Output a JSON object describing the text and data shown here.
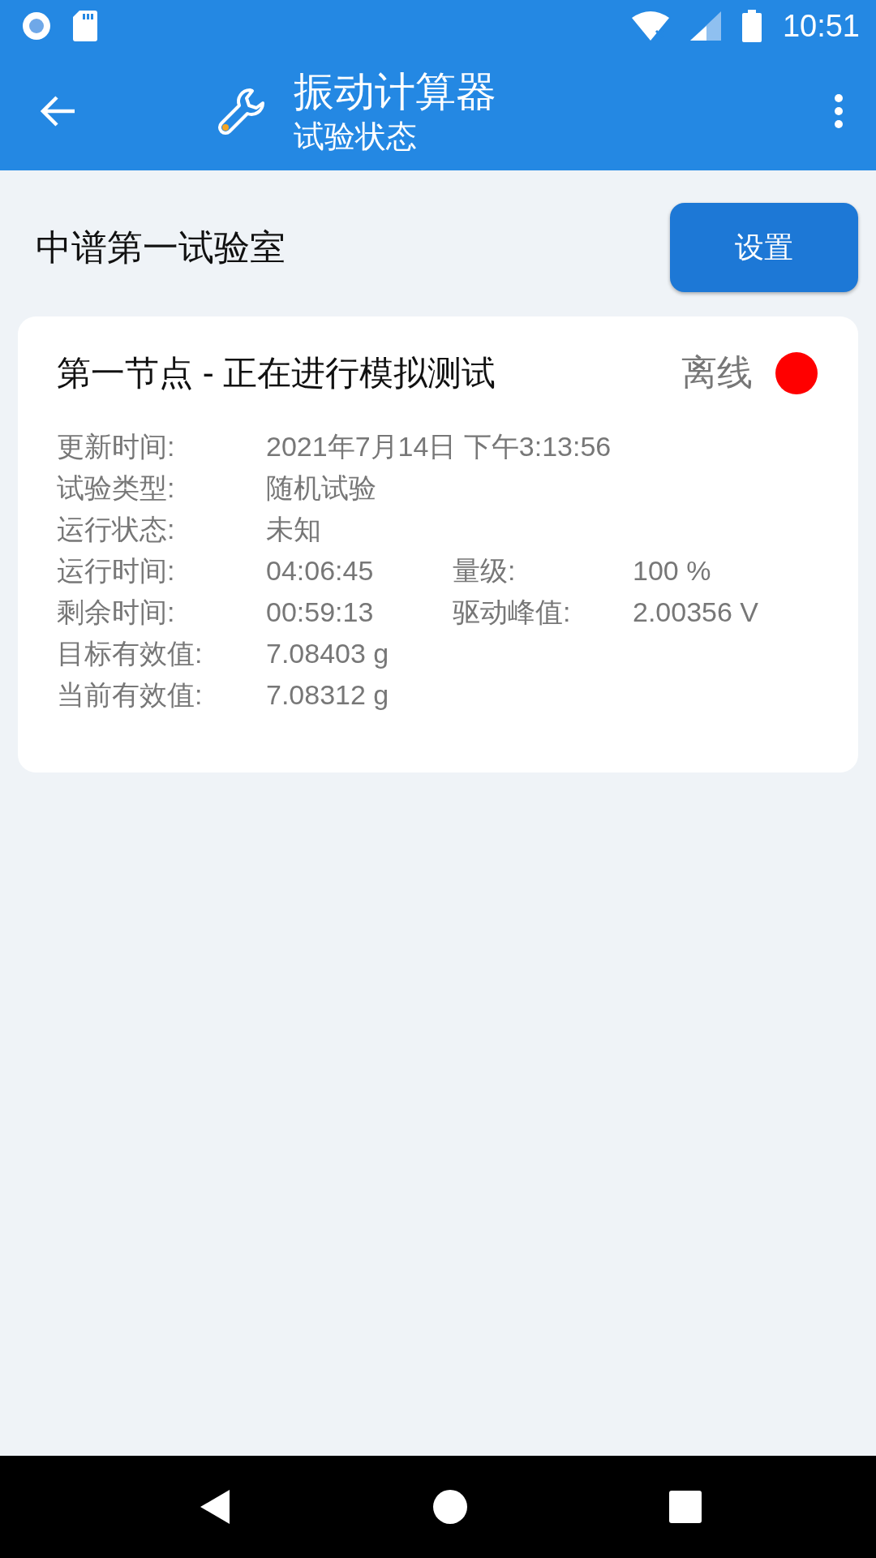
{
  "status_bar": {
    "time": "10:51"
  },
  "app_bar": {
    "title": "振动计算器",
    "subtitle": "试验状态"
  },
  "lab": {
    "name": "中谱第一试验室",
    "button": "设置"
  },
  "node": {
    "title": "第一节点 - 正在进行模拟测试",
    "status": "离线",
    "online": false,
    "rows": [
      [
        {
          "label": "更新时间:",
          "value": "2021年7月14日 下午3:13:56"
        }
      ],
      [
        {
          "label": "试验类型:",
          "value": "随机试验"
        }
      ],
      [
        {
          "label": "运行状态:",
          "value": "未知"
        }
      ],
      [
        {
          "label": "运行时间:",
          "value": "04:06:45"
        },
        {
          "label": "量级:",
          "value": "100 %"
        }
      ],
      [
        {
          "label": "剩余时间:",
          "value": "00:59:13"
        },
        {
          "label": "驱动峰值:",
          "value": "2.00356 V"
        }
      ],
      [
        {
          "label": "目标有效值:",
          "value": "7.08403 g"
        }
      ],
      [
        {
          "label": "当前有效值:",
          "value": "7.08312 g"
        }
      ]
    ]
  }
}
